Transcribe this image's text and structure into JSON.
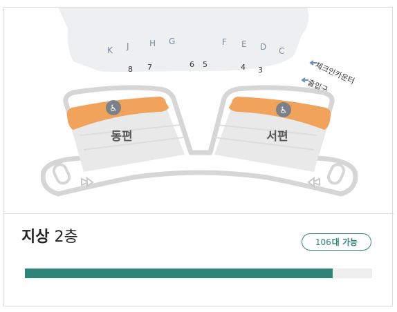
{
  "map": {
    "gates_left": [
      "K",
      "J",
      "H",
      "G"
    ],
    "gates_right": [
      "F",
      "E",
      "D",
      "C"
    ],
    "spots_left": [
      "8",
      "7",
      "6"
    ],
    "spots_right": [
      "5",
      "4",
      "3"
    ],
    "checkin_label": "체크인카운터",
    "exit_label": "출입구",
    "zone_east": "동편",
    "zone_west": "서편"
  },
  "floor": {
    "name_bold": "지상",
    "name_rest": "2층"
  },
  "availability": {
    "count": "106",
    "suffix": "대 가능",
    "ratio": 0.886
  },
  "colors": {
    "accent": "#2f8479",
    "orange": "#f1a25b",
    "track": "#efefef"
  }
}
